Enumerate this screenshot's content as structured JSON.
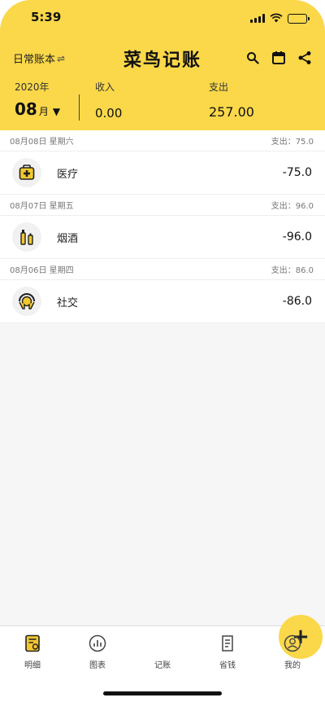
{
  "status": {
    "time": "5:39"
  },
  "header": {
    "book_label": "日常账本",
    "swap_icon": "⇌",
    "app_title": "菜鸟记账",
    "year": "2020年",
    "month": "08",
    "month_unit": "月",
    "caret": "▼",
    "income_label": "收入",
    "income_value": "0.00",
    "expense_label": "支出",
    "expense_value": "257.00"
  },
  "days": [
    {
      "date": "08月08日 星期六",
      "total": "支出：75.0",
      "record": {
        "category": "医疗",
        "icon": "medical-kit-icon",
        "amount": "-75.0"
      }
    },
    {
      "date": "08月07日 星期五",
      "total": "支出：96.0",
      "record": {
        "category": "烟酒",
        "icon": "bottles-icon",
        "amount": "-96.0"
      }
    },
    {
      "date": "08月06日 星期四",
      "total": "支出：86.0",
      "record": {
        "category": "社交",
        "icon": "social-icon",
        "amount": "-86.0"
      }
    }
  ],
  "tabs": {
    "detail": "明细",
    "chart": "图表",
    "add": "记账",
    "save": "省钱",
    "mine": "我的",
    "add_symbol": "+"
  },
  "colors": {
    "accent": "#fad84a",
    "background": "#f6f6f6"
  }
}
